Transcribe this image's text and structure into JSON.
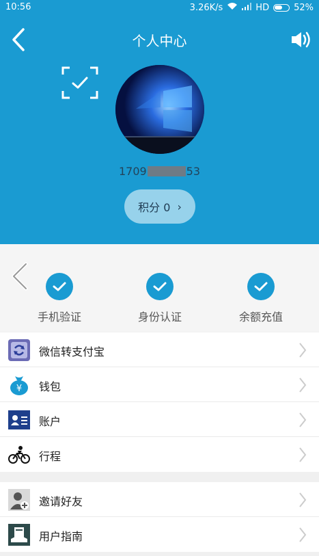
{
  "status_bar": {
    "time": "10:56",
    "speed": "3.26K/s",
    "network": "HD",
    "battery": "52%"
  },
  "header": {
    "title": "个人中心",
    "phone_prefix": "1709",
    "phone_suffix": "53",
    "points_label": "积分 0",
    "points_chevron": "›"
  },
  "verify": [
    {
      "label": "手机验证"
    },
    {
      "label": "身份认证"
    },
    {
      "label": "余额充值"
    }
  ],
  "menu_group_1": [
    {
      "label": "微信转支付宝",
      "icon": "transfer-icon"
    },
    {
      "label": "钱包",
      "icon": "wallet-icon"
    },
    {
      "label": "账户",
      "icon": "account-icon"
    },
    {
      "label": "行程",
      "icon": "bicycle-icon"
    }
  ],
  "menu_group_2": [
    {
      "label": "邀请好友",
      "icon": "invite-friend-icon"
    },
    {
      "label": "用户指南",
      "icon": "guide-icon"
    }
  ],
  "colors": {
    "primary": "#1a9bd2",
    "background": "#f0f0f0"
  }
}
